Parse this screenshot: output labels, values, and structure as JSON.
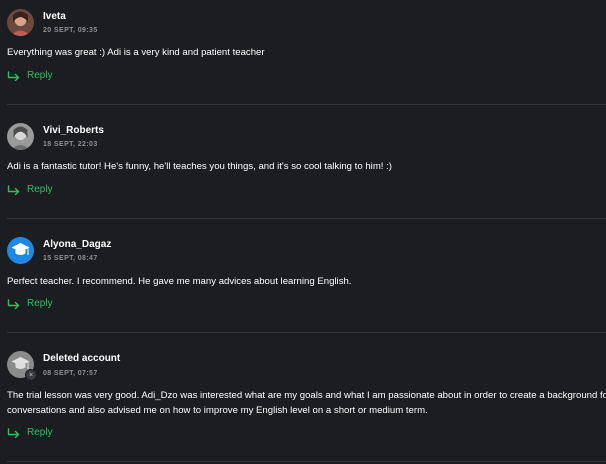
{
  "comments": [
    {
      "author": "Iveta",
      "timestamp": "20 SEPT, 09:35",
      "text": [
        "Everything was great :) Adi is a very kind and patient teacher"
      ],
      "reply_label": "Reply"
    },
    {
      "author": "Vivi_Roberts",
      "timestamp": "18 SEPT, 22:03",
      "text": [
        "Adi is a fantastic tutor! He's funny, he'll teaches you things, and it's so cool talking to him! :)"
      ],
      "reply_label": "Reply"
    },
    {
      "author": "Alyona_Dagaz",
      "timestamp": "15 SEPT, 08:47",
      "text": [
        "Perfect teacher. I recommend. He gave me many advices about learning English."
      ],
      "reply_label": "Reply"
    },
    {
      "author": "Deleted account",
      "timestamp": "08 SEPT, 07:57",
      "text": [
        "The trial lesson was very good. Adi_Dzo was interested what are my goals and what I am passionate about in order to create a background for",
        "conversations and also advised me on how to improve my English level on a short or medium term."
      ],
      "reply_label": "Reply"
    }
  ],
  "colors": {
    "background": "#1c1d20",
    "text": "#ffffff",
    "timestamp": "#8e8f94",
    "reply_accent": "#22c55e",
    "divider": "#34363b",
    "avatar_blue": "#1e88e5",
    "avatar_gray": "#8a8a8a"
  },
  "icons": {
    "reply": "reply-arrow-icon",
    "deleted_badge": "close-icon",
    "graduation_cap": "graduation-cap-icon"
  }
}
